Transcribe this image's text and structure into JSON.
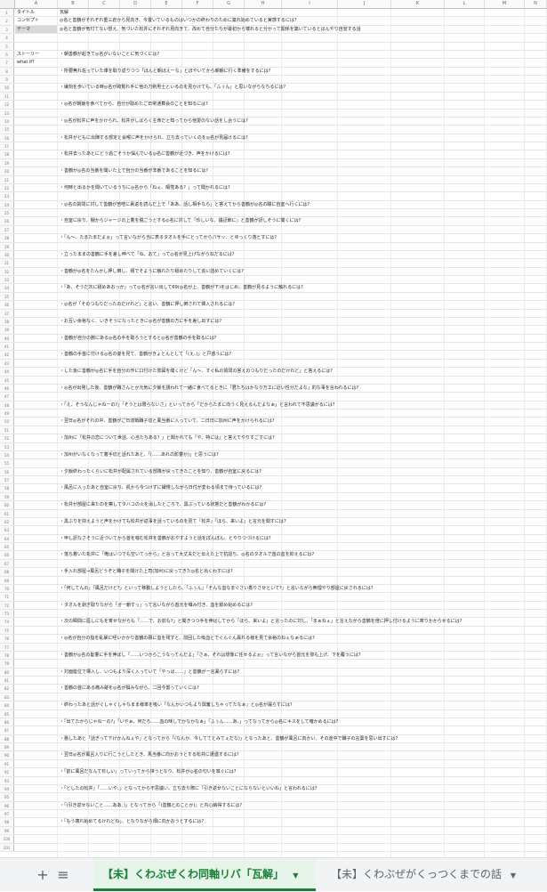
{
  "columns": [
    "A",
    "B",
    "C",
    "D",
    "E",
    "F",
    "G",
    "H",
    "I",
    "J",
    "K",
    "L",
    "M",
    "N"
  ],
  "rows": [
    {
      "n": "1",
      "a": "タイトル",
      "b": "瓦解"
    },
    {
      "n": "2",
      "a": "コンセプト",
      "b": "◎名と善鶴がそれぞれ重三倉から見向き、今置いているものはいつかの終わりのために築れ始めていると実感するには?"
    },
    {
      "n": "3",
      "a": "テーマ",
      "b": "◎名と善鶴が気付てない想え、気づいた松井にそれぞれ見向きて、改めて自分たちが最初から壊れると分かって関係を築いているとばんやり自覚する話",
      "gray": true
    },
    {
      "n": "4",
      "a": "",
      "b": ""
    },
    {
      "n": "5",
      "a": "",
      "b": ""
    },
    {
      "n": "6",
      "a": "ストーリー",
      "b": "・朝善鶴が起きて◎名がいないことに気づくには?"
    },
    {
      "n": "7",
      "a": "what if?",
      "b": ""
    },
    {
      "n": "8",
      "a": "",
      "b": "・所要無れ佐っていた車を取り返りつつ「ほんと朝ほえーな」とぼやいてから朝朝に行く準備をするには?"
    },
    {
      "n": "9",
      "a": "",
      "b": ""
    },
    {
      "n": "10",
      "a": "",
      "b": "・繊刻を歩いている時◎名が跨覧れ手に他の刀剣男士といるのを見かけても、「ふぅん」と思いながらなちるには?"
    },
    {
      "n": "11",
      "a": "",
      "b": ""
    },
    {
      "n": "12",
      "a": "",
      "b": "・◎名が朝飯を食べてから、自分が取めたご日常通算会のことを知るには?"
    },
    {
      "n": "13",
      "a": "",
      "b": ""
    },
    {
      "n": "14",
      "a": "",
      "b": "・◎名が松井に声をかけられ、松井がしばらく主命だと知ってから他愛のない話をし合うには?"
    },
    {
      "n": "15",
      "a": "",
      "b": ""
    },
    {
      "n": "16",
      "a": "",
      "b": "・松井がどもに出陣する部定と会喉に声をかけられ、立ち去っていくのを◎名が見届けるには?"
    },
    {
      "n": "17",
      "a": "",
      "b": ""
    },
    {
      "n": "18",
      "a": "",
      "b": "・松井去ったあとにどう過ごそうか悩んでいる◎名に善鶴が近づき、声をかけるには?"
    },
    {
      "n": "19",
      "a": "",
      "b": ""
    },
    {
      "n": "20",
      "a": "",
      "b": "・善鶴が◎名の当番を聞いた上で自分の当番が非番であることを知るには?"
    },
    {
      "n": "21",
      "a": "",
      "b": ""
    },
    {
      "n": "22",
      "a": "",
      "b": "・何時と出るかを聞いているうちに◎名から「ねぇ、暇党ある？」って聞かれるには?"
    },
    {
      "n": "23",
      "a": "",
      "b": ""
    },
    {
      "n": "24",
      "a": "",
      "b": "・◎名の質問に対して善鶴が苦喧に裏返を読んだ上で「ああ、話し相手なら」と答えてから善鶴が◎名の瞳に自室へ行くには?"
    },
    {
      "n": "25",
      "a": "",
      "b": ""
    },
    {
      "n": "26",
      "a": "",
      "b": "・自室に戻り、棚からジャージの上着を脱ごうとする◎名に対して「珍しいな、議記節に」と善鶴が訝しそうに聞くには?"
    },
    {
      "n": "27",
      "a": "",
      "b": ""
    },
    {
      "n": "28",
      "a": "",
      "b": "・「ん〜、たまたまだよぉ」って言いながら当に表るタオルを手にとってからパサッ、とゆっくり落とすには?"
    },
    {
      "n": "29",
      "a": "",
      "b": ""
    },
    {
      "n": "30",
      "a": "",
      "b": "・立ったままの善鶴に手を差し伸べて「ね、おて」って◎名が見上げながらねだるには?"
    },
    {
      "n": "31",
      "a": "",
      "b": ""
    },
    {
      "n": "32",
      "a": "",
      "b": "・善鶴が◎名をたんかし押し倒し、頬でそように触れたり舐めたりして追い詰めていくには?"
    },
    {
      "n": "33",
      "a": "",
      "b": ""
    },
    {
      "n": "34",
      "a": "",
      "b": "・「あ、そうだ次に舐めあおっか」って◎名が言い出して69(◎名が上、善鶴が下)をはじめ、善鶴が見るように触れるには?"
    },
    {
      "n": "35",
      "a": "",
      "b": ""
    },
    {
      "n": "36",
      "a": "",
      "b": "・◎名が「そのつもりだったのだけれど」と言い、善鶴に押し倒されて挿入されるには?"
    },
    {
      "n": "37",
      "a": "",
      "b": ""
    },
    {
      "n": "38",
      "a": "",
      "b": "・お互い余裕なく、いきそうになったときに◎名が善鶴の方に手を差し出すには?"
    },
    {
      "n": "39",
      "a": "",
      "b": ""
    },
    {
      "n": "40",
      "a": "",
      "b": "・善鶴が自分の腕にある◎名の手を取ろうとすると◎名が善鶴の手を取るには?"
    },
    {
      "n": "41",
      "a": "",
      "b": ""
    },
    {
      "n": "42",
      "a": "",
      "b": "・善鶴の手首に付ける◎名の姿を見て、善鶴がきょとんとして「(え、)」と戸惑うには?"
    },
    {
      "n": "43",
      "a": "",
      "b": ""
    },
    {
      "n": "44",
      "a": "",
      "b": "・した後に善鶴が◎名に手を自分の作に口付けた意図を聞くけど「ん〜、すぐ私の質問の答えのつもりだったのだけれど」と答えるには?"
    },
    {
      "n": "45",
      "a": "",
      "b": ""
    },
    {
      "n": "46",
      "a": "",
      "b": "・◎名が出発した後、善鶴が職さんとか元気に夕飯を誘われて一緒に食べてるときに「君たちはかなり万工に近い性分だよな」的な事を言われるには?"
    },
    {
      "n": "47",
      "a": "",
      "b": ""
    },
    {
      "n": "48",
      "a": "",
      "b": "・「え、そうなんじゃねーの?」「そうとは限らないさ」といってから「だからたまに向うく見えるんだよなぁ」と言われて不思議がるには?"
    },
    {
      "n": "49",
      "a": "",
      "b": ""
    },
    {
      "n": "50",
      "a": "",
      "b": "・翌日◎名がそれの中、善鶴がご日達戦職子切と風当番に入っていて、二日日に加州に声をかけられるには?"
    },
    {
      "n": "51",
      "a": "",
      "b": ""
    },
    {
      "n": "52",
      "a": "",
      "b": "・加州に「松井の恋について世話、心当たちある？」と聞かれても「や、特には」と答えてやりすごすには?"
    },
    {
      "n": "53",
      "a": "",
      "b": ""
    },
    {
      "n": "54",
      "a": "",
      "b": "・加州がいなくなって着手切と話れたあと、「(……あれの影響か)」と思うには?"
    },
    {
      "n": "55",
      "a": "",
      "b": ""
    },
    {
      "n": "56",
      "a": "",
      "b": "・夕飯終わったくらいに松井が配属されている部隊が戻ってきたことを知り、善鶴が自室に戻るには?"
    },
    {
      "n": "57",
      "a": "",
      "b": ""
    },
    {
      "n": "58",
      "a": "",
      "b": "・風呂に入ったあと自室に戻り、机から今つけずに撮慢しながら日付が変わる頃まで待っているには?"
    },
    {
      "n": "59",
      "a": "",
      "b": ""
    },
    {
      "n": "60",
      "a": "",
      "b": "・松井が部屋に来たのを察してタバコの火を消したところで、黒ぶっている状態だと善鶴がわかるには?"
    },
    {
      "n": "61",
      "a": "",
      "b": ""
    },
    {
      "n": "62",
      "a": "",
      "b": "・黒ぶりを抑えようと声をかけても松井が返事を話っているのを見て「松井」「ほら、来いよ」と言元を聞すには?"
    },
    {
      "n": "63",
      "a": "",
      "b": ""
    },
    {
      "n": "64",
      "a": "",
      "b": "・申し訳なさそうに近づいてから首を噛む松井を善鶴がおやすようと話をぽんぽん、とやりつづけるには?"
    },
    {
      "n": "65",
      "a": "",
      "b": ""
    },
    {
      "n": "66",
      "a": "",
      "b": "・落ち着いた松井に「俺はいつでも空いてっから」と言って大丈夫だと伝えた上で抗認ち、◎名のタオルで首の血を抑えるには?"
    },
    {
      "n": "67",
      "a": "",
      "b": ""
    },
    {
      "n": "68",
      "a": "",
      "b": "・手入れ部屋→風呂どうぞと職子を聞けた上司(加州)に戻ってきた◎名と出くわすには?"
    },
    {
      "n": "69",
      "a": "",
      "b": ""
    },
    {
      "n": "70",
      "a": "",
      "b": "・「何してんの」「風呂だけど?」といって移動しようとしたら、「ふぅん」「そんな血なまぐさい香りさせといて?」と言いながら無理やり部屋に戻されるには?"
    },
    {
      "n": "71",
      "a": "",
      "b": ""
    },
    {
      "n": "72",
      "a": "",
      "b": "・タオルを剥ぎ取りながら「ガー鎖すっ」って言いながら首元を囁み付き、血を舐め始めるには?"
    },
    {
      "n": "73",
      "a": "",
      "b": ""
    },
    {
      "n": "74",
      "a": "",
      "b": "・次の瞬間に唇しにもを寄せながらも「……で、お前も?」と聞きつつ手を伸ばしてから「ほら、来いよ」と言ったのに対し、「まぁねぇ」と言えながら善鶴を燈に押し付けるように寄りかからせるには?"
    },
    {
      "n": "75",
      "a": "",
      "b": ""
    },
    {
      "n": "76",
      "a": "",
      "b": "・◎名が自分の指を乱暴に咥いかかり善鶴の頚に血を残すと、前回した吸血とでぐんぐん異れる様を見て余裕のねぇなぁるには?"
    },
    {
      "n": "77",
      "a": "",
      "b": ""
    },
    {
      "n": "78",
      "a": "",
      "b": "・善鶴が◎名の髪響に手を伸ばし「……いつからこうなってんだよ」「さぁ、それは想像に任せるよぉ」って言いながら首元を抑も上げ、下を覆うには?"
    },
    {
      "n": "79",
      "a": "",
      "b": ""
    },
    {
      "n": "80",
      "a": "",
      "b": "・対面座位で挿入し、いつもより深く入っていて「やっば……」と善鶴が一言漏らすには?"
    },
    {
      "n": "81",
      "a": "",
      "b": ""
    },
    {
      "n": "82",
      "a": "",
      "b": "・善鶴の首にある痛み跡を◎名が掴みながら、二回今置っていくには?"
    },
    {
      "n": "83",
      "a": "",
      "b": ""
    },
    {
      "n": "84",
      "a": "",
      "b": "・終わったあと話がぐしゃぐしゃなまま様率を吸い「なんかいつもより興奮しちゃってたなぁ」と◎名が漏らすには?"
    },
    {
      "n": "85",
      "a": "",
      "b": ""
    },
    {
      "n": "86",
      "a": "",
      "b": "・「出てたからじゃねーの?」「いやぁ、何だろ……血の味しでかなかなぁ」「ふぅん……あ、」ってなってから◎名にキスをして確かめるには?"
    },
    {
      "n": "87",
      "a": "",
      "b": ""
    },
    {
      "n": "88",
      "a": "",
      "b": "・悪したあと「話ぎって下げかんねぇや」となってから「(なんか、今しててとみてぇだな)」となったあと、善鶴が風呂に向かい、その途中で職子の言葉を思い出すには?"
    },
    {
      "n": "89",
      "a": "",
      "b": ""
    },
    {
      "n": "90",
      "a": "",
      "b": "・翌日◎名が風呂入りに行こうとしたとき、馬当番に向かおうとする松井に遭遇するには?"
    },
    {
      "n": "91",
      "a": "",
      "b": ""
    },
    {
      "n": "92",
      "a": "",
      "b": "・「前に風呂だなんて珍しい」っていってから挟うとなり、松井が◎名の匂いを嗅ぐには?"
    },
    {
      "n": "93",
      "a": "",
      "b": ""
    },
    {
      "n": "94",
      "a": "",
      "b": "・「どしたの松井」「……いや、」となってから不思議い、立ち去り際に「引き返せないことにならないといいね」と言われるには?"
    },
    {
      "n": "95",
      "a": "",
      "b": ""
    },
    {
      "n": "96",
      "a": "",
      "b": "・「(引き返せないこと……ああ、)」となってから「(善鶴とのことか)」と内心納得するには?"
    },
    {
      "n": "97",
      "a": "",
      "b": ""
    },
    {
      "n": "98",
      "a": "",
      "b": "・「もう壊れ始めてるけれどね」、となりながら畑に向かおうとするには?"
    },
    {
      "n": "99",
      "a": "",
      "b": ""
    },
    {
      "n": "100",
      "a": "",
      "b": ""
    },
    {
      "n": "101",
      "a": "",
      "b": ""
    }
  ],
  "tabbar": {
    "add_icon": "+",
    "list_icon": "≡",
    "active_tab": "【未】くわぶぜくわ同軸リバ「瓦解」",
    "inactive_tab": "【未】くわぶぜがくっつくまでの話",
    "dropdown_glyph": "▼"
  },
  "colors": {
    "active_tab_text": "#188038",
    "active_tab_bg": "#e6f4ea",
    "header_bg": "#f8f9fa",
    "gray_cell": "#d9d9d9"
  }
}
